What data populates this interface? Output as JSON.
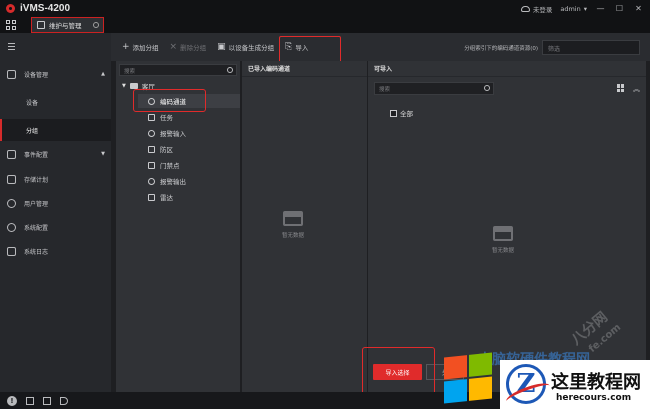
{
  "window": {
    "title": "iVMS-4200",
    "cloud_status": "未登录",
    "user": "admin",
    "user_caret": "▾",
    "minimize": "—",
    "maximize": "☐",
    "close": "✕"
  },
  "tabs": [
    {
      "label": "维护与管理"
    }
  ],
  "sidebar": {
    "items": [
      {
        "label": "设备管理",
        "caret": "▲"
      },
      {
        "label": "设备"
      },
      {
        "label": "分组"
      },
      {
        "label": "事件配置",
        "caret": "▼"
      },
      {
        "label": "存储计划"
      },
      {
        "label": "用户管理"
      },
      {
        "label": "系统配置"
      },
      {
        "label": "系统日志"
      }
    ]
  },
  "toolbar": {
    "add_group": "添加分组",
    "delete_group": "删除分组",
    "create_by_device": "以设备生成分组",
    "import": "导入",
    "hint": "分组索引下的编码通道资源(0)",
    "filter_placeholder": "筛选"
  },
  "tree": {
    "search_placeholder": "搜索",
    "root": "客厅",
    "items": [
      {
        "label": "编码通道"
      },
      {
        "label": "任务"
      },
      {
        "label": "报警输入"
      },
      {
        "label": "防区"
      },
      {
        "label": "门禁点"
      },
      {
        "label": "报警输出"
      },
      {
        "label": "雷达"
      }
    ]
  },
  "imported_panel": {
    "title": "已导入编码通道",
    "empty_text": "暂无数据"
  },
  "importable_panel": {
    "title": "可导入",
    "search_placeholder": "搜索",
    "check_all": "全部",
    "empty_text": "暂无数据"
  },
  "buttons": {
    "import_selected": "导入选择",
    "close": "关"
  },
  "watermark": {
    "diag": "八分网",
    "diag2": "fe.com",
    "bottom": "电脑软硬件教程网",
    "brand_name": "这里教程网",
    "brand_url": "herecours.com",
    "brand_letter": "Z"
  }
}
